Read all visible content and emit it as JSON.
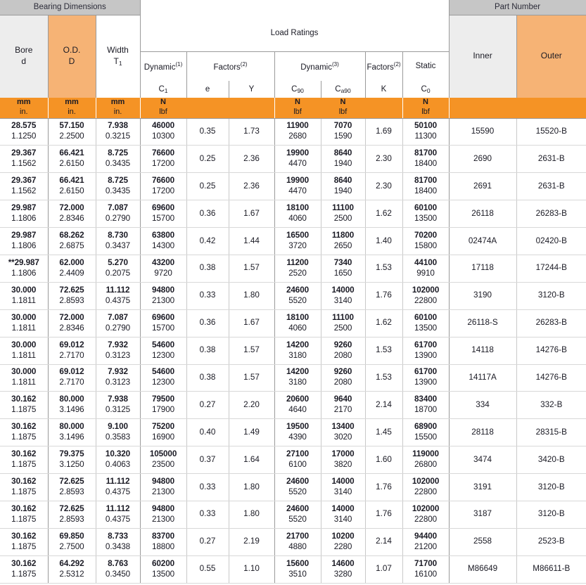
{
  "table": {
    "groups": {
      "bearing_dimensions": "Bearing Dimensions",
      "load_ratings": "Load Ratings",
      "part_number": "Part Number"
    },
    "columns": {
      "bore": {
        "label": "Bore",
        "symbol": "d"
      },
      "od": {
        "label": "O.D.",
        "symbol": "D"
      },
      "width": {
        "label": "Width",
        "symbol": "T",
        "symbol_sub": "1"
      },
      "dynamic1": {
        "label": "Dynamic",
        "note": "(1)",
        "symbol": "C",
        "symbol_sub": "1"
      },
      "factors1": {
        "label": "Factors",
        "note": "(2)",
        "symbol_e": "e",
        "symbol_y": "Y"
      },
      "dynamic3": {
        "label": "Dynamic",
        "note": "(3)",
        "symbol_c90": "C",
        "symbol_c90_sub": "90",
        "symbol_ca90": "C",
        "symbol_ca90_sub": "a90"
      },
      "factors2": {
        "label": "Factors",
        "note": "(2)",
        "symbol_k": "K"
      },
      "static": {
        "label": "Static",
        "symbol": "C",
        "symbol_sub": "0"
      },
      "inner": {
        "label": "Inner"
      },
      "outer": {
        "label": "Outer"
      }
    },
    "units": {
      "mm": "mm",
      "in": "in.",
      "n": "N",
      "lbf": "lbf"
    },
    "rows": [
      {
        "bore_mm": "28.575",
        "bore_in": "1.1250",
        "od_mm": "57.150",
        "od_in": "2.2500",
        "w_mm": "7.938",
        "w_in": "0.3215",
        "c1_n": "46000",
        "c1_lbf": "10300",
        "e": "0.35",
        "y": "1.73",
        "c90_n": "11900",
        "c90_lbf": "2680",
        "ca90_n": "7070",
        "ca90_lbf": "1590",
        "k": "1.69",
        "c0_n": "50100",
        "c0_lbf": "11300",
        "inner": "15590",
        "outer": "15520-B"
      },
      {
        "bore_mm": "29.367",
        "bore_in": "1.1562",
        "od_mm": "66.421",
        "od_in": "2.6150",
        "w_mm": "8.725",
        "w_in": "0.3435",
        "c1_n": "76600",
        "c1_lbf": "17200",
        "e": "0.25",
        "y": "2.36",
        "c90_n": "19900",
        "c90_lbf": "4470",
        "ca90_n": "8640",
        "ca90_lbf": "1940",
        "k": "2.30",
        "c0_n": "81700",
        "c0_lbf": "18400",
        "inner": "2690",
        "outer": "2631-B"
      },
      {
        "bore_mm": "29.367",
        "bore_in": "1.1562",
        "od_mm": "66.421",
        "od_in": "2.6150",
        "w_mm": "8.725",
        "w_in": "0.3435",
        "c1_n": "76600",
        "c1_lbf": "17200",
        "e": "0.25",
        "y": "2.36",
        "c90_n": "19900",
        "c90_lbf": "4470",
        "ca90_n": "8640",
        "ca90_lbf": "1940",
        "k": "2.30",
        "c0_n": "81700",
        "c0_lbf": "18400",
        "inner": "2691",
        "outer": "2631-B"
      },
      {
        "bore_mm": "29.987",
        "bore_in": "1.1806",
        "od_mm": "72.000",
        "od_in": "2.8346",
        "w_mm": "7.087",
        "w_in": "0.2790",
        "c1_n": "69600",
        "c1_lbf": "15700",
        "e": "0.36",
        "y": "1.67",
        "c90_n": "18100",
        "c90_lbf": "4060",
        "ca90_n": "11100",
        "ca90_lbf": "2500",
        "k": "1.62",
        "c0_n": "60100",
        "c0_lbf": "13500",
        "inner": "26118",
        "outer": "26283-B"
      },
      {
        "bore_mm": "29.987",
        "bore_in": "1.1806",
        "od_mm": "68.262",
        "od_in": "2.6875",
        "w_mm": "8.730",
        "w_in": "0.3437",
        "c1_n": "63800",
        "c1_lbf": "14300",
        "e": "0.42",
        "y": "1.44",
        "c90_n": "16500",
        "c90_lbf": "3720",
        "ca90_n": "11800",
        "ca90_lbf": "2650",
        "k": "1.40",
        "c0_n": "70200",
        "c0_lbf": "15800",
        "inner": "02474A",
        "outer": "02420-B"
      },
      {
        "bore_mm": "**29.987",
        "bore_in": "1.1806",
        "od_mm": "62.000",
        "od_in": "2.4409",
        "w_mm": "5.270",
        "w_in": "0.2075",
        "c1_n": "43200",
        "c1_lbf": "9720",
        "e": "0.38",
        "y": "1.57",
        "c90_n": "11200",
        "c90_lbf": "2520",
        "ca90_n": "7340",
        "ca90_lbf": "1650",
        "k": "1.53",
        "c0_n": "44100",
        "c0_lbf": "9910",
        "inner": "17118",
        "outer": "17244-B"
      },
      {
        "bore_mm": "30.000",
        "bore_in": "1.1811",
        "od_mm": "72.625",
        "od_in": "2.8593",
        "w_mm": "11.112",
        "w_in": "0.4375",
        "c1_n": "94800",
        "c1_lbf": "21300",
        "e": "0.33",
        "y": "1.80",
        "c90_n": "24600",
        "c90_lbf": "5520",
        "ca90_n": "14000",
        "ca90_lbf": "3140",
        "k": "1.76",
        "c0_n": "102000",
        "c0_lbf": "22800",
        "inner": "3190",
        "outer": "3120-B"
      },
      {
        "bore_mm": "30.000",
        "bore_in": "1.1811",
        "od_mm": "72.000",
        "od_in": "2.8346",
        "w_mm": "7.087",
        "w_in": "0.2790",
        "c1_n": "69600",
        "c1_lbf": "15700",
        "e": "0.36",
        "y": "1.67",
        "c90_n": "18100",
        "c90_lbf": "4060",
        "ca90_n": "11100",
        "ca90_lbf": "2500",
        "k": "1.62",
        "c0_n": "60100",
        "c0_lbf": "13500",
        "inner": "26118-S",
        "outer": "26283-B"
      },
      {
        "bore_mm": "30.000",
        "bore_in": "1.1811",
        "od_mm": "69.012",
        "od_in": "2.7170",
        "w_mm": "7.932",
        "w_in": "0.3123",
        "c1_n": "54600",
        "c1_lbf": "12300",
        "e": "0.38",
        "y": "1.57",
        "c90_n": "14200",
        "c90_lbf": "3180",
        "ca90_n": "9260",
        "ca90_lbf": "2080",
        "k": "1.53",
        "c0_n": "61700",
        "c0_lbf": "13900",
        "inner": "14118",
        "outer": "14276-B"
      },
      {
        "bore_mm": "30.000",
        "bore_in": "1.1811",
        "od_mm": "69.012",
        "od_in": "2.7170",
        "w_mm": "7.932",
        "w_in": "0.3123",
        "c1_n": "54600",
        "c1_lbf": "12300",
        "e": "0.38",
        "y": "1.57",
        "c90_n": "14200",
        "c90_lbf": "3180",
        "ca90_n": "9260",
        "ca90_lbf": "2080",
        "k": "1.53",
        "c0_n": "61700",
        "c0_lbf": "13900",
        "inner": "14117A",
        "outer": "14276-B"
      },
      {
        "bore_mm": "30.162",
        "bore_in": "1.1875",
        "od_mm": "80.000",
        "od_in": "3.1496",
        "w_mm": "7.938",
        "w_in": "0.3125",
        "c1_n": "79500",
        "c1_lbf": "17900",
        "e": "0.27",
        "y": "2.20",
        "c90_n": "20600",
        "c90_lbf": "4640",
        "ca90_n": "9640",
        "ca90_lbf": "2170",
        "k": "2.14",
        "c0_n": "83400",
        "c0_lbf": "18700",
        "inner": "334",
        "outer": "332-B"
      },
      {
        "bore_mm": "30.162",
        "bore_in": "1.1875",
        "od_mm": "80.000",
        "od_in": "3.1496",
        "w_mm": "9.100",
        "w_in": "0.3583",
        "c1_n": "75200",
        "c1_lbf": "16900",
        "e": "0.40",
        "y": "1.49",
        "c90_n": "19500",
        "c90_lbf": "4390",
        "ca90_n": "13400",
        "ca90_lbf": "3020",
        "k": "1.45",
        "c0_n": "68900",
        "c0_lbf": "15500",
        "inner": "28118",
        "outer": "28315-B"
      },
      {
        "bore_mm": "30.162",
        "bore_in": "1.1875",
        "od_mm": "79.375",
        "od_in": "3.1250",
        "w_mm": "10.320",
        "w_in": "0.4063",
        "c1_n": "105000",
        "c1_lbf": "23500",
        "e": "0.37",
        "y": "1.64",
        "c90_n": "27100",
        "c90_lbf": "6100",
        "ca90_n": "17000",
        "ca90_lbf": "3820",
        "k": "1.60",
        "c0_n": "119000",
        "c0_lbf": "26800",
        "inner": "3474",
        "outer": "3420-B"
      },
      {
        "bore_mm": "30.162",
        "bore_in": "1.1875",
        "od_mm": "72.625",
        "od_in": "2.8593",
        "w_mm": "11.112",
        "w_in": "0.4375",
        "c1_n": "94800",
        "c1_lbf": "21300",
        "e": "0.33",
        "y": "1.80",
        "c90_n": "24600",
        "c90_lbf": "5520",
        "ca90_n": "14000",
        "ca90_lbf": "3140",
        "k": "1.76",
        "c0_n": "102000",
        "c0_lbf": "22800",
        "inner": "3191",
        "outer": "3120-B"
      },
      {
        "bore_mm": "30.162",
        "bore_in": "1.1875",
        "od_mm": "72.625",
        "od_in": "2.8593",
        "w_mm": "11.112",
        "w_in": "0.4375",
        "c1_n": "94800",
        "c1_lbf": "21300",
        "e": "0.33",
        "y": "1.80",
        "c90_n": "24600",
        "c90_lbf": "5520",
        "ca90_n": "14000",
        "ca90_lbf": "3140",
        "k": "1.76",
        "c0_n": "102000",
        "c0_lbf": "22800",
        "inner": "3187",
        "outer": "3120-B"
      },
      {
        "bore_mm": "30.162",
        "bore_in": "1.1875",
        "od_mm": "69.850",
        "od_in": "2.7500",
        "w_mm": "8.733",
        "w_in": "0.3438",
        "c1_n": "83700",
        "c1_lbf": "18800",
        "e": "0.27",
        "y": "2.19",
        "c90_n": "21700",
        "c90_lbf": "4880",
        "ca90_n": "10200",
        "ca90_lbf": "2280",
        "k": "2.14",
        "c0_n": "94400",
        "c0_lbf": "21200",
        "inner": "2558",
        "outer": "2523-B"
      },
      {
        "bore_mm": "30.162",
        "bore_in": "1.1875",
        "od_mm": "64.292",
        "od_in": "2.5312",
        "w_mm": "8.763",
        "w_in": "0.3450",
        "c1_n": "60200",
        "c1_lbf": "13500",
        "e": "0.55",
        "y": "1.10",
        "c90_n": "15600",
        "c90_lbf": "3510",
        "ca90_n": "14600",
        "ca90_lbf": "3280",
        "k": "1.07",
        "c0_n": "71700",
        "c0_lbf": "16100",
        "inner": "M86649",
        "outer": "M86611-B"
      }
    ]
  },
  "colors": {
    "band_gray": "#c6c6c6",
    "highlight_orange": "#f6b375",
    "units_orange": "#f59325",
    "light_gray": "#ededed"
  }
}
